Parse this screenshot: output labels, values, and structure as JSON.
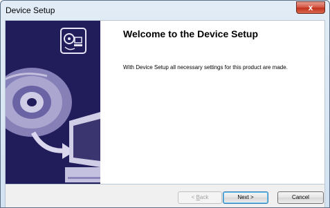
{
  "window": {
    "title": "Device Setup",
    "close_glyph": "x"
  },
  "sidebar": {
    "icon": "setup-emblem-icon",
    "illustration": "cd-to-computer-illustration",
    "background": "#211c5a"
  },
  "main": {
    "heading": "Welcome to the Device Setup",
    "description": "With Device Setup all necessary settings for this product are made."
  },
  "buttons": {
    "back_mnemonic": "B",
    "back_rest": "ack",
    "back_prefix": "< ",
    "next_label": "Next >",
    "cancel_label": "Cancel"
  }
}
